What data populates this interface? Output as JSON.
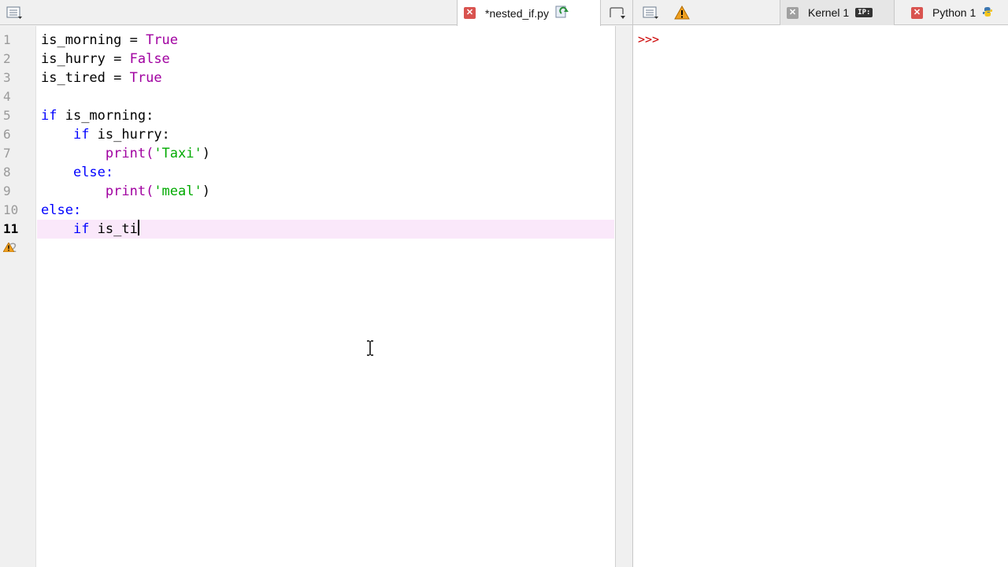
{
  "editor": {
    "tab": {
      "label": "*nested_if.py"
    },
    "lines": [
      {
        "num": "1"
      },
      {
        "num": "2"
      },
      {
        "num": "3"
      },
      {
        "num": "4"
      },
      {
        "num": "5"
      },
      {
        "num": "6"
      },
      {
        "num": "7"
      },
      {
        "num": "8"
      },
      {
        "num": "9"
      },
      {
        "num": "10"
      },
      {
        "num": "11"
      },
      {
        "num": "2"
      }
    ],
    "code": {
      "l1_var": "is_morning",
      "l1_eq": " = ",
      "l1_val": "True",
      "l2_var": "is_hurry",
      "l2_eq": " = ",
      "l2_val": "False",
      "l3_var": "is_tired",
      "l3_eq": " = ",
      "l3_val": "True",
      "l5_kw": "if",
      "l5_rest": " is_morning:",
      "l6_indent": "    ",
      "l6_kw": "if",
      "l6_rest": " is_hurry:",
      "l7_indent": "        ",
      "l7_fn": "print(",
      "l7_str": "'Taxi'",
      "l7_close": ")",
      "l8_indent": "    ",
      "l8_kw": "else:",
      "l9_indent": "        ",
      "l9_fn": "print(",
      "l9_str": "'meal'",
      "l9_close": ")",
      "l10_kw": "else:",
      "l11_indent": "    ",
      "l11_kw": "if",
      "l11_rest": " is_ti"
    }
  },
  "console": {
    "tabs": [
      {
        "label": "Kernel 1",
        "badge": "IP:"
      },
      {
        "label": "Python 1"
      }
    ],
    "prompt": ">>>"
  },
  "colors": {
    "keyword": "#0000ff",
    "constant": "#a000a0",
    "string": "#00aa00",
    "prompt": "#cc0000",
    "current_line": "#fae8fa"
  }
}
